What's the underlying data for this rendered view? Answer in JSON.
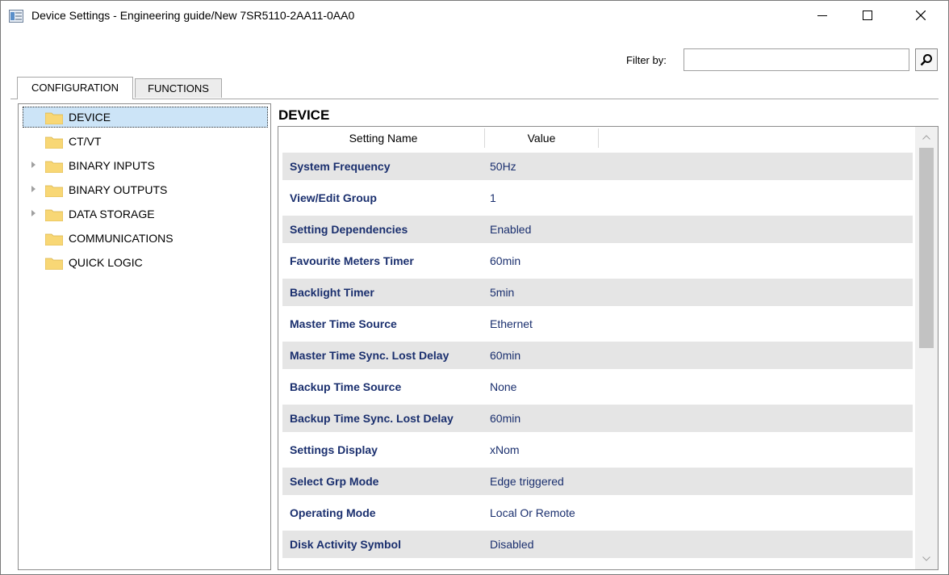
{
  "window": {
    "title": "Device Settings - Engineering guide/New 7SR5110-2AA11-0AA0",
    "controls": {
      "minimize": "minimize-icon",
      "maximize": "maximize-icon",
      "close": "close-icon"
    }
  },
  "filter": {
    "label": "Filter by:",
    "value": "",
    "placeholder": "",
    "button_icon": "search-icon"
  },
  "tabs": [
    {
      "label": "CONFIGURATION",
      "active": true
    },
    {
      "label": "FUNCTIONS",
      "active": false
    }
  ],
  "tree": {
    "items": [
      {
        "label": "DEVICE",
        "selected": true,
        "expandable": false
      },
      {
        "label": "CT/VT",
        "selected": false,
        "expandable": false
      },
      {
        "label": "BINARY INPUTS",
        "selected": false,
        "expandable": true
      },
      {
        "label": "BINARY OUTPUTS",
        "selected": false,
        "expandable": true
      },
      {
        "label": "DATA STORAGE",
        "selected": false,
        "expandable": true
      },
      {
        "label": "COMMUNICATIONS",
        "selected": false,
        "expandable": false
      },
      {
        "label": "QUICK LOGIC",
        "selected": false,
        "expandable": false
      }
    ]
  },
  "section": {
    "title": "DEVICE"
  },
  "grid": {
    "columns": [
      "Setting Name",
      "Value"
    ],
    "rows": [
      {
        "name": "System Frequency",
        "value": "50Hz"
      },
      {
        "name": "View/Edit Group",
        "value": "1"
      },
      {
        "name": "Setting Dependencies",
        "value": "Enabled"
      },
      {
        "name": "Favourite Meters Timer",
        "value": "60min"
      },
      {
        "name": "Backlight Timer",
        "value": "5min"
      },
      {
        "name": "Master Time Source",
        "value": "Ethernet"
      },
      {
        "name": "Master Time Sync. Lost Delay",
        "value": "60min"
      },
      {
        "name": "Backup Time Source",
        "value": "None"
      },
      {
        "name": "Backup Time Sync. Lost Delay",
        "value": "60min"
      },
      {
        "name": "Settings Display",
        "value": "xNom"
      },
      {
        "name": "Select Grp Mode",
        "value": "Edge triggered"
      },
      {
        "name": "Operating Mode",
        "value": "Local Or Remote"
      },
      {
        "name": "Disk Activity Symbol",
        "value": "Disabled"
      }
    ]
  },
  "colors": {
    "value_text": "#1a2f6e",
    "row_shade": "#e5e5e5",
    "selection": "#cce4f7",
    "folder": "#f8d775"
  }
}
